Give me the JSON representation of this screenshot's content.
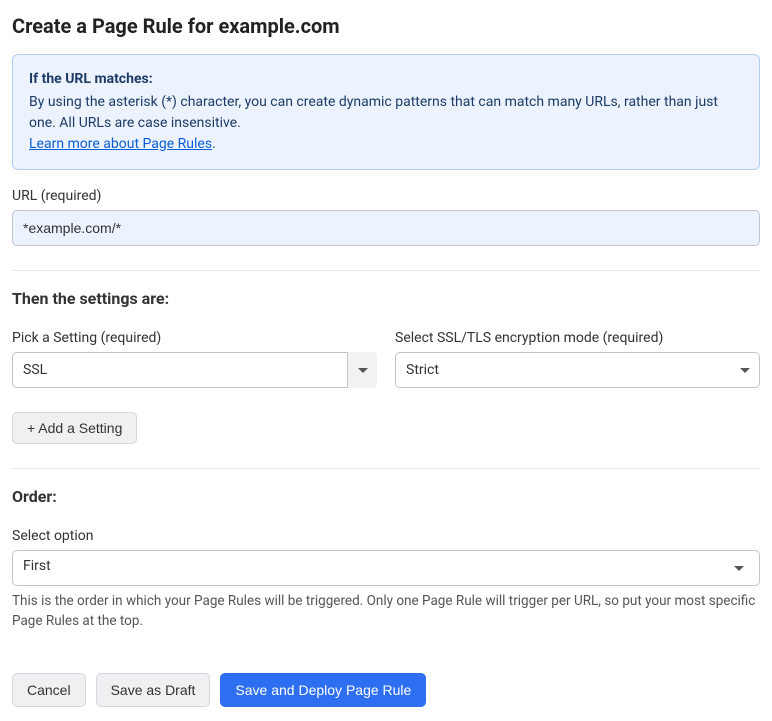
{
  "header": {
    "title": "Create a Page Rule for example.com"
  },
  "info": {
    "title": "If the URL matches:",
    "body": "By using the asterisk (*) character, you can create dynamic patterns that can match many URLs, rather than just one. All URLs are case insensitive.",
    "link_text": "Learn more about Page Rules",
    "period": "."
  },
  "url": {
    "label": "URL (required)",
    "value": "*example.com/*"
  },
  "settings": {
    "heading": "Then the settings are:",
    "pick_label": "Pick a Setting (required)",
    "pick_value": "SSL",
    "mode_label": "Select SSL/TLS encryption mode (required)",
    "mode_value": "Strict",
    "add_setting_label": "+ Add a Setting"
  },
  "order": {
    "heading": "Order:",
    "select_label": "Select option",
    "value": "First",
    "help": "This is the order in which your Page Rules will be triggered. Only one Page Rule will trigger per URL, so put your most specific Page Rules at the top."
  },
  "actions": {
    "cancel": "Cancel",
    "save_draft": "Save as Draft",
    "save_deploy": "Save and Deploy Page Rule"
  }
}
